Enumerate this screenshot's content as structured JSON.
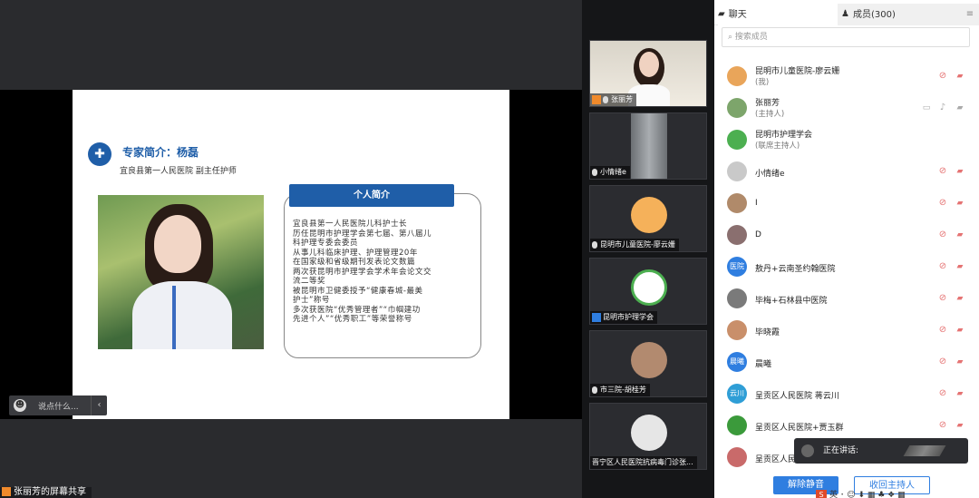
{
  "slide": {
    "title": "专家简介：杨磊",
    "subtitle": "宜良县第一人民医院   副主任护师",
    "intro_heading": "个人简介",
    "intro_lines": [
      "宜良县第一人民医院儿科护士长",
      "历任昆明市护理学会第七届、第八届儿",
      "科护理专委会委员",
      "从事儿科临床护理、护理管理20年",
      "在国家级和省级期刊发表论文数篇",
      "两次获昆明市护理学会学术年会论文交",
      "流二等奖",
      "被昆明市卫健委授予“健康春城-最美",
      "护士”称号",
      "多次获医院“优秀管理者”“巾帼建功",
      "先进个人”“优秀职工”等荣誉称号"
    ]
  },
  "chat": {
    "placeholder": "说点什么...",
    "arrow": "‹"
  },
  "share_label": "张丽芳的屏幕共享",
  "videos": [
    {
      "name": "张丽芳",
      "role_icon": "host-icon"
    },
    {
      "name": "小情绪e"
    },
    {
      "name": "昆明市儿童医院-廖云姗"
    },
    {
      "name": "昆明市护理学会",
      "role_icon": "member-icon"
    },
    {
      "name": "市三院-胡桂芳"
    },
    {
      "name": "晋宁区人民医院抗病毒门诊张..."
    }
  ],
  "panel": {
    "tab_chat": "聊天",
    "tab_members": "成员(300)",
    "search_placeholder": "搜索成员",
    "members": [
      {
        "name": "昆明市儿童医院-廖云姗",
        "role": "(我)",
        "color": "#e9a55a"
      },
      {
        "name": "张丽芳",
        "role": "(主持人)",
        "color": "#7da56b"
      },
      {
        "name": "昆明市护理学会",
        "role": "(联席主持人)",
        "color": "#4caf50"
      },
      {
        "name": "小情绪e",
        "role": "",
        "color": "#c9c9c9"
      },
      {
        "name": "I",
        "role": "",
        "color": "#b08a6a"
      },
      {
        "name": "D",
        "role": "",
        "color": "#8a6f6f"
      },
      {
        "name": "敖丹+云南圣约翰医院",
        "role": "",
        "color": "#2f7ee0",
        "badge": "医院"
      },
      {
        "name": "毕梅+石林县中医院",
        "role": "",
        "color": "#7a7a7a"
      },
      {
        "name": "毕晓霞",
        "role": "",
        "color": "#c98f6a"
      },
      {
        "name": "晨曦",
        "role": "",
        "color": "#2f7ee0",
        "badge": "晨曦"
      },
      {
        "name": "呈贡区人民医院  蒋云川",
        "role": "",
        "color": "#2f9ed6",
        "badge": "云川"
      },
      {
        "name": "呈贡区人民医院+贾玉群",
        "role": "",
        "color": "#3b9a3b"
      },
      {
        "name": "呈贡区人民",
        "role": "",
        "color": "#c96a6a"
      }
    ],
    "speaking_label": "正在讲话:",
    "unmute_button": "解除静音",
    "reclaim_host_button": "收回主持人"
  },
  "tray": "英 ･ ☺ ⬇ ▦ ♣ ❖ ▦"
}
